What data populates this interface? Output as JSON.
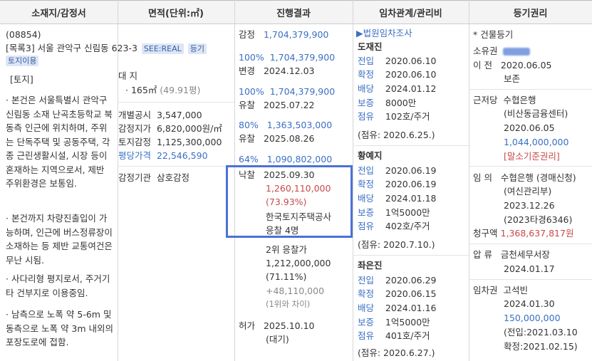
{
  "headers": [
    "소재지/감정서",
    "면적(단위:㎡)",
    "진행결과",
    "임차관계/관리비",
    "등기권리"
  ],
  "col1": {
    "zip": "(08854)",
    "addr": "[목록3] 서울 관악구 신림동 623-3",
    "tag1": "SEE:REAL",
    "tag2": "등기",
    "tag3": "토지이용",
    "land_label": "[토지]",
    "desc1": "본건은 서울특별시 관악구 신림동 소재 난곡초등학교 북동측 인근에 위치하며, 주위는 단독주택 및 공동주택, 각종 근린생활시설, 시장 등이 혼재하는 지역으로서, 제반 주위환경은 보통임.",
    "desc2": "본건까지 차량진출입이 가능하며, 인근에 버스정류장이 소재하는 등 제반 교통여건은 무난 시됨.",
    "desc3": "사다리형 평지로서, 주거기타 건부지로 이용중임.",
    "desc4": "남측으로 노폭 약 5-6m 및 동측으로 노폭 약 3m 내외의 포장도로에 접함."
  },
  "col2": {
    "land": "대 지",
    "area": "· 165㎡",
    "area_py": "(49.91평)",
    "r1_l": "개별공시",
    "r1_v": "3,547,000",
    "r2_l": "감정지가",
    "r2_v": "6,820,000원/㎡",
    "r3_l": "토지감정",
    "r3_v": "1,125,300,000",
    "r4_l": "평당가격",
    "r4_v": "22,546,590",
    "agency_l": "감정기관",
    "agency_v": "삼호감정"
  },
  "col3": {
    "appr_l": "감정",
    "appr_v": "1,704,379,900",
    "p1": "100%",
    "p1v": "1,704,379,900",
    "ch_l": "변경",
    "ch_d": "2024.12.03",
    "p2": "100%",
    "p2v": "1,704,379,900",
    "f1_l": "유찰",
    "f1_d": "2025.07.22",
    "p3": "80%",
    "p3v": "1,363,503,000",
    "f2_l": "유찰",
    "f2_d": "2025.08.26",
    "p4": "64%",
    "p4v": "1,090,802,000",
    "win_l": "낙찰",
    "win_d": "2025.09.30",
    "win_amt": "1,260,110,000",
    "win_pct": "(73.93%)",
    "winner": "한국토지주택공사",
    "bidders": "응찰 4명",
    "second": "2위 응찰가",
    "second_amt": "1,212,000,000",
    "second_pct": "(71.11%)",
    "diff": "+48,110,000",
    "diff_note": "(1위와 차이)",
    "perm_l": "허가",
    "perm_d": "2025.10.10",
    "perm_note": "(대기)"
  },
  "col4": {
    "title": "▶법원임차조사",
    "t1": {
      "name": "도재진",
      "r": [
        [
          "전입",
          "2020.06.10"
        ],
        [
          "확정",
          "2020.06.10"
        ],
        [
          "배당",
          "2024.01.12"
        ],
        [
          "보증",
          "8000만"
        ],
        [
          "점유",
          "102호/주거"
        ]
      ],
      "note": "(점유: 2020.6.25.)"
    },
    "t2": {
      "name": "황예지",
      "r": [
        [
          "전입",
          "2020.06.19"
        ],
        [
          "확정",
          "2020.06.19"
        ],
        [
          "배당",
          "2024.01.18"
        ],
        [
          "보증",
          "1억5000만"
        ],
        [
          "점유",
          "402호/주거"
        ]
      ],
      "note": "(점유: 2020.7.10.)"
    },
    "t3": {
      "name": "좌은진",
      "r": [
        [
          "전입",
          "2020.06.29"
        ],
        [
          "확정",
          "2020.06.15"
        ],
        [
          "배당",
          "2024.01.16"
        ],
        [
          "보증",
          "1억5000만"
        ],
        [
          "점유",
          "401호/주거"
        ]
      ],
      "note": "(점유: 2020.6.27.)"
    }
  },
  "col5": {
    "title": "* 건물등기",
    "own_l": "소유권",
    "tr_l": "이 전",
    "tr_d": "2020.06.05",
    "tr_n": "보존",
    "mort_l": "근저당",
    "mort_v": "수협은행",
    "mort_sub": "(비산동금융센터)",
    "mort_d": "2020.06.05",
    "mort_amt": "1,044,000,000",
    "mort_note": "[말소기준권리]",
    "auc_l": "임 의",
    "auc_v": "수협은행 (경매신청)",
    "auc_sub": "(여신관리부)",
    "auc_d": "2023.12.26",
    "auc_case": "(2023타경6346)",
    "claim_l": "청구액",
    "claim_v": "1,368,637,817원",
    "seiz_l": "압 류",
    "seiz_v": "금천세무서장",
    "seiz_d": "2024.01.17",
    "lease_l": "임차권",
    "lease_v": "고석빈",
    "lease_d": "2024.01.30",
    "lease_amt": "150,000,000",
    "lease_in": "(전입:2021.03.10",
    "lease_cf": "확정:2021.02.15)"
  }
}
